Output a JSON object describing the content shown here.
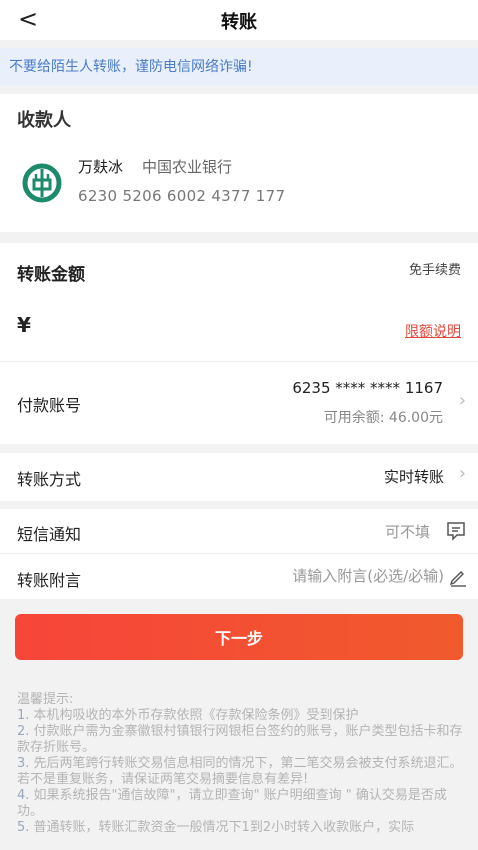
{
  "nav": {
    "back_glyph": "<",
    "title": "转账"
  },
  "notice": "不要给陌生人转账，谨防电信网络诈骗!",
  "payee": {
    "heading": "收款人",
    "name": "万麸冰",
    "bank": "中国农业银行",
    "account": "6230 5206 6002 4377 177",
    "logo_icon": "abc-bank-logo-icon",
    "logo_color": "#1d8a6c"
  },
  "amount": {
    "heading": "转账金额",
    "fee_note": "免手续费",
    "currency": "¥",
    "limit_link": "限额说明"
  },
  "pay_account": {
    "label": "付款账号",
    "number": "6235 **** **** 1167",
    "balance": "可用余额: 46.00元"
  },
  "transfer_method": {
    "label": "转账方式",
    "value": "实时转账"
  },
  "sms": {
    "label": "短信通知",
    "value": "可不填"
  },
  "memo": {
    "label": "转账附言",
    "placeholder": "请输入附言(必选/必输)"
  },
  "next_button": "下一步",
  "tips": {
    "title": "温馨提示:",
    "items": [
      {
        "num": "1.",
        "text": "本机构吸收的本外币存款依照《存款保险条例》受到保护"
      },
      {
        "num": "2.",
        "text": "付款账户需为金寨徽银村镇银行网银柜台签约的账号，账户类型包括卡和存款存折账号。"
      },
      {
        "num": "3.",
        "text": "先后两笔跨行转账交易信息相同的情况下，第二笔交易会被支付系统退汇。若不是重复账务，请保证两笔交易摘要信息有差异!"
      },
      {
        "num": "4.",
        "text": "如果系统报告\"通信故障\"，请立即查询\" 账户明细查询 \" 确认交易是否成功。"
      },
      {
        "num": "5.",
        "text": "普通转账，转账汇款资金一般情况下1到2小时转入收款账户，实际"
      }
    ]
  },
  "colors": {
    "accent": "#f7453a",
    "notice_text": "#4a7cc9",
    "limit_link": "#e04a3c"
  }
}
